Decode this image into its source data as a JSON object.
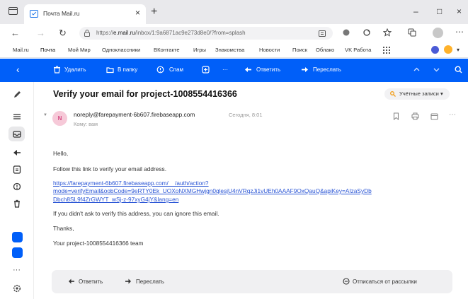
{
  "browser": {
    "tab_title": "Почта Mail.ru",
    "tab_close": "×",
    "new_tab": "+",
    "url_prefix": "https://",
    "url_host": "e.mail.ru",
    "url_path": "/inbox/1:9a6871ac9e273d8e0/?from=splash",
    "window_controls": [
      "–",
      "□",
      "×"
    ]
  },
  "portal": {
    "items": [
      "Mail.ru",
      "Почта",
      "Мой Мир",
      "Одноклассники",
      "ВКонтакте",
      "Игры",
      "Знакомства",
      "Новости",
      "Поиск",
      "Облако",
      "VK Работа"
    ]
  },
  "toolbar": {
    "delete_label": "Удалить",
    "to_folder_label": "В папку",
    "spam_label": "Спам",
    "more_label": "···",
    "reply_label": "Ответить",
    "forward_label": "Переслать"
  },
  "mail": {
    "subject": "Verify your email for project-1008554416366",
    "folder_chip": "Учётные записи",
    "avatar_letter": "N",
    "sender": "noreply@farepayment-6b607.firebaseapp.com",
    "date": "Сегодня, 8:01",
    "recipient": "Кому: вам",
    "body": {
      "greeting": "Hello,",
      "intro": "Follow this link to verify your email address.",
      "link_line1": "https://farepayment-6b607.firebaseapp.com/__/auth/action?",
      "link_line2": "mode=verifyEmail&oobCode=9eRTY0Ek_UOXoNXMGHwjgn0qlesjU4nVRqzJi1vUEh0AAAF9OxQauQ&apiKey=AIzaSyDb",
      "link_line3": "Dbch8SL9f4ZrGWYT_wSj-z-97xyG4jY&lang=en",
      "ignore": "If you didn't ask to verify this address, you can ignore this email.",
      "thanks": "Thanks,",
      "signature": "Your project-1008554416366 team"
    }
  },
  "reply_panel": {
    "reply_label": "Ответить",
    "forward_label": "Переслать",
    "unsubscribe_label": "Отписаться от рассылки"
  },
  "colors": {
    "accent": "#005ff9",
    "link": "#2a55d5",
    "chip_icon": "#f29f1b"
  },
  "icons": [
    "window-icon",
    "mail-favicon",
    "back-arrow-icon",
    "forward-arrow-icon",
    "refresh-icon",
    "lock-icon",
    "star-icon",
    "extensions-icon",
    "edit-icon",
    "menu-icon",
    "inbox-icon",
    "sent-icon",
    "drafts-icon",
    "spam-icon",
    "trash-icon",
    "cloud-icon",
    "contacts-icon",
    "settings-icon"
  ]
}
